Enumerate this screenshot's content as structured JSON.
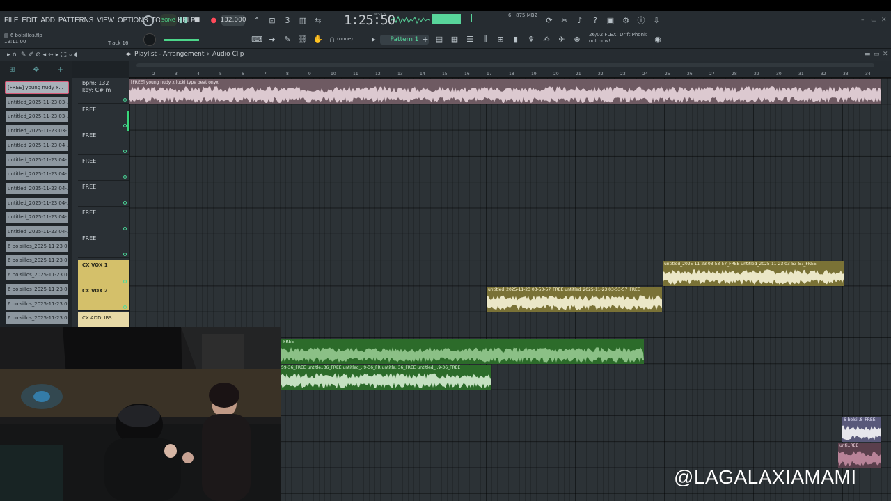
{
  "menu": [
    "FILE",
    "EDIT",
    "ADD",
    "PATTERNS",
    "VIEW",
    "OPTIONS",
    "TOOLS",
    "HELP"
  ],
  "file": {
    "name": "6 bolsillos.flp",
    "time": "19:11:00"
  },
  "track_hint": "Track 16",
  "transport": {
    "mode": "SONG",
    "tempo": "132.000",
    "time": "1:25:50",
    "time_label": "M:S:CS"
  },
  "cpu": {
    "voices": "6",
    "ram": "875 MB",
    "cores": "2"
  },
  "pattern": "Pattern 1",
  "snap": "(none)",
  "news": {
    "line1": "26/02  FLEX: Drift Phonk",
    "line2": "out now!"
  },
  "playlist": {
    "title": "Playlist - Arrangement",
    "sub": "Audio Clip"
  },
  "ruler_ticks": [
    "2",
    "3",
    "4",
    "5",
    "6",
    "7",
    "8",
    "9",
    "10",
    "11",
    "12",
    "13",
    "14",
    "15",
    "16",
    "17",
    "18",
    "19",
    "20",
    "21",
    "22",
    "23",
    "24",
    "25",
    "26",
    "27",
    "28",
    "29",
    "30",
    "31",
    "32",
    "33",
    "34"
  ],
  "picker_items": [
    "[FREE] young nudy x...",
    "untitled_2025-11-23 03-...",
    "untitled_2025-11-23 03-...",
    "untitled_2025-11-23 03-...",
    "untitled_2025-11-23 04-...",
    "untitled_2025-11-23 04-...",
    "untitled_2025-11-23 04-...",
    "untitled_2025-11-23 04-...",
    "untitled_2025-11-23 04-...",
    "untitled_2025-11-23 04-...",
    "untitled_2025-11-23 04-...",
    "6 bolsillos_2025-11-23 0...",
    "6 bolsillos_2025-11-23 0...",
    "6 bolsillos_2025-11-23 0...",
    "6 bolsillos_2025-11-23 0...",
    "6 bolsillos_2025-11-23 0...",
    "6 bolsillos_2025-11-23 0..."
  ],
  "tracks": [
    {
      "name": "bpm: 132",
      "extra": "key: C# m"
    },
    {
      "name": "FREE"
    },
    {
      "name": "FREE"
    },
    {
      "name": "FREE"
    },
    {
      "name": "FREE"
    },
    {
      "name": "FREE"
    },
    {
      "name": "FREE"
    },
    {
      "name": "CX VOX 1"
    },
    {
      "name": "CX VOX 2"
    },
    {
      "name": "CX ADDLIBS"
    }
  ],
  "clips": {
    "main": "[FREE] young nudy x lucki type beat  onyx",
    "vox1": "untitled_2025-11-23 03-53-57_FREE  untitled_2025-11-23 03-53-57_FREE",
    "vox2": "untitled_2025-11-23 03-53-57_FREE  untitled_2025-11-23 03-53-57_FREE",
    "green1": "_FREE",
    "green2": "59-36_FREE  untitle..36_FREE  untitled_..9-36_FR  untitle..36_FREE  untitled_..9-36_FREE",
    "blue": "6 bolsi..8_FREE",
    "pink": "unti..REE"
  },
  "watermark": "@LAGALAXIAMAMI",
  "colors": {
    "accent": "#4dd68a",
    "clip_main": "#6e5a62",
    "vox": "#d4c06a",
    "green": "#2c6b2a"
  }
}
